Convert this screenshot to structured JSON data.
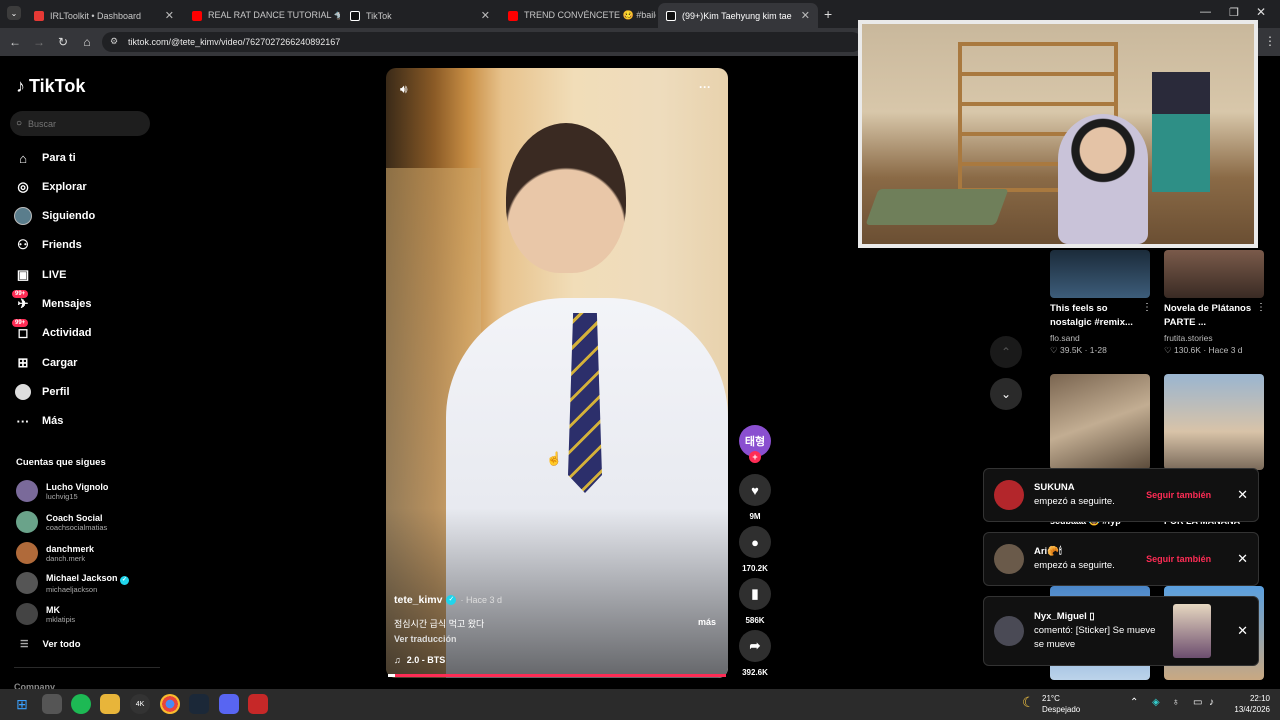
{
  "tabs": [
    {
      "title": "IRLToolkit • Dashboard",
      "color": "#e53935"
    },
    {
      "title": "REAL RAT DANCE TUTORIAL 🐀",
      "color": "#ff0000"
    },
    {
      "title": "TikTok",
      "color": "#ffffff"
    },
    {
      "title": "TREND CONVÉNCETE 🥴 #baile",
      "color": "#ff0000"
    },
    {
      "title": "(99+)Kim Taehyung kim tae",
      "color": "#ffffff"
    }
  ],
  "url": "tiktok.com/@tete_kimv/video/7627027266240892167",
  "brand": "TikTok",
  "search_placeholder": "Buscar",
  "nav": [
    {
      "label": "Para ti",
      "icon": "home-icon"
    },
    {
      "label": "Explorar",
      "icon": "compass-icon"
    },
    {
      "label": "Siguiendo",
      "icon": "following-avatar-icon"
    },
    {
      "label": "Friends",
      "icon": "friends-icon"
    },
    {
      "label": "LIVE",
      "icon": "live-icon"
    },
    {
      "label": "Mensajes",
      "icon": "messages-icon",
      "badge": "99+"
    },
    {
      "label": "Actividad",
      "icon": "activity-icon",
      "badge": "99+"
    },
    {
      "label": "Cargar",
      "icon": "upload-icon"
    },
    {
      "label": "Perfil",
      "icon": "profile-icon"
    },
    {
      "label": "Más",
      "icon": "more-icon"
    }
  ],
  "following_header": "Cuentas que sigues",
  "accounts": [
    {
      "name": "Lucho Vignolo",
      "user": "luchvig15",
      "color": "#7a6a9a"
    },
    {
      "name": "Coach Social",
      "user": "coachsocialmatias",
      "color": "#6aa38a"
    },
    {
      "name": "danchmerk",
      "user": "danch.merk",
      "color": "#b06a3a"
    },
    {
      "name": "Michael Jackson",
      "user": "michaeljackson",
      "color": "#555555",
      "verified": true
    },
    {
      "name": "MK",
      "user": "mklatipis",
      "color": "#444444"
    }
  ],
  "see_all": "Ver todo",
  "company": "Company",
  "video": {
    "author": "tete_kimv",
    "time": "· Hace 3 d",
    "caption": "점심시간 급식 먹고 왔다",
    "translate": "Ver traducción",
    "more": "más",
    "music": "2.0 - BTS",
    "progress": 0.02,
    "avatar_text": "태형",
    "likes": "9M",
    "comments": "170.2K",
    "saves": "586K",
    "shares": "392.6K"
  },
  "recommended": [
    {
      "title": "This feels so nostalgic #remix...",
      "user": "flo.sand",
      "likes": "39.5K",
      "time": "1-28"
    },
    {
      "title": "Novela de Plátanos PARTE ...",
      "user": "frutita.stories",
      "likes": "130.6K",
      "time": "Hace 3 d"
    }
  ],
  "partial_titles": [
    "scubaaa 😂 #fyp",
    "POR LA MAÑANA"
  ],
  "notifications": [
    {
      "name": "SUKUNA",
      "text": "empezó a seguirte.",
      "action": "Seguir también"
    },
    {
      "name": "Ari🥐🕯",
      "text": "empezó a seguirte.",
      "action": "Seguir también"
    },
    {
      "name": "Nyx_Miguel ▯",
      "text": "comentó: [Sticker] Se mueve se mueve"
    }
  ],
  "weather": {
    "temp": "21°C",
    "status": "Despejado"
  },
  "clock": {
    "time": "22:10",
    "date": "13/4/2026"
  }
}
